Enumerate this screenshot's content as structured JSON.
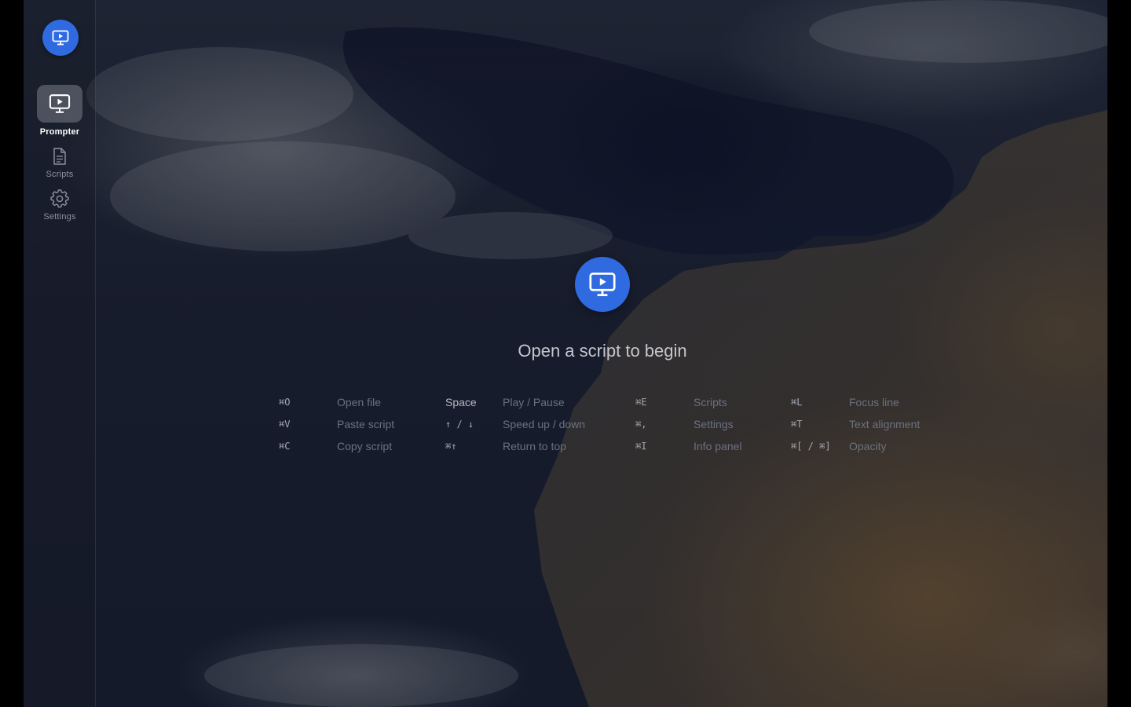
{
  "app": {
    "logo_icon": "presentation-screen-icon",
    "accent_color": "#2f6ae0"
  },
  "sidebar": {
    "items": [
      {
        "label": "Prompter",
        "icon": "presentation-screen-icon",
        "active": true
      },
      {
        "label": "Scripts",
        "icon": "document-icon",
        "active": false
      },
      {
        "label": "Settings",
        "icon": "gear-icon",
        "active": false
      }
    ]
  },
  "main": {
    "empty_icon": "presentation-screen-icon",
    "headline": "Open a script to begin"
  },
  "shortcuts": {
    "groups": [
      {
        "rows": [
          {
            "key": "⌘O",
            "action": "Open file"
          },
          {
            "key": "⌘V",
            "action": "Paste script"
          },
          {
            "key": "⌘C",
            "action": "Copy script"
          }
        ]
      },
      {
        "rows": [
          {
            "key": "Space",
            "action": "Play / Pause"
          },
          {
            "key": "↑ / ↓",
            "action": "Speed up / down"
          },
          {
            "key": "⌘↑",
            "action": "Return to top"
          }
        ]
      },
      {
        "rows": [
          {
            "key": "⌘E",
            "action": "Scripts"
          },
          {
            "key": "⌘,",
            "action": "Settings"
          },
          {
            "key": "⌘I",
            "action": "Info panel"
          }
        ]
      },
      {
        "rows": [
          {
            "key": "⌘L",
            "action": "Focus line"
          },
          {
            "key": "⌘T",
            "action": "Text alignment"
          },
          {
            "key": "⌘[ / ⌘]",
            "action": "Opacity"
          }
        ]
      }
    ]
  }
}
